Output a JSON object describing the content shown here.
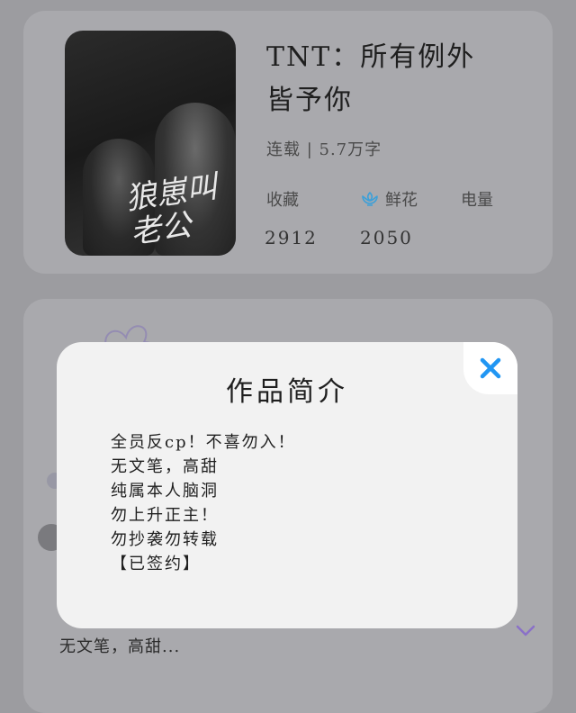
{
  "book": {
    "title": "TNT：所有例外皆予你",
    "status_line": "连载 | 5.7万字",
    "cover_title": "狼崽叫老公",
    "stats": {
      "collect_label": "收藏",
      "collect_value": "2912",
      "flower_label": "鲜花",
      "flower_value": "2050",
      "power_label": "电量"
    }
  },
  "summary_preview": "无文笔，高甜...",
  "modal": {
    "title": "作品简介",
    "lines": [
      "全员反cp！不喜勿入！",
      "无文笔，高甜",
      "纯属本人脑洞",
      "勿上升正主！",
      "勿抄袭勿转载",
      "【已签约】"
    ]
  },
  "colors": {
    "close_icon": "#2196f3",
    "accent_flower": "#3da0d8",
    "chevron": "#8a70c8"
  }
}
